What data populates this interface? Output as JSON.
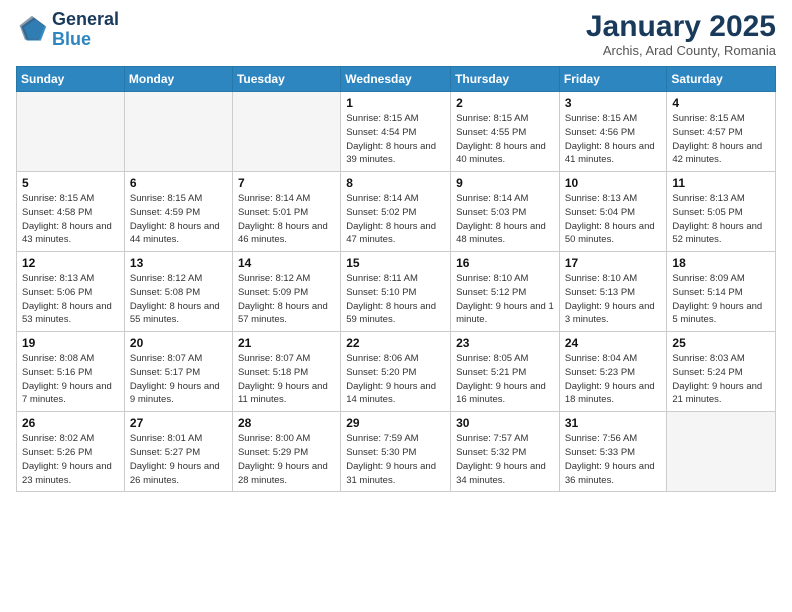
{
  "header": {
    "logo_general": "General",
    "logo_blue": "Blue",
    "month_title": "January 2025",
    "subtitle": "Archis, Arad County, Romania"
  },
  "weekdays": [
    "Sunday",
    "Monday",
    "Tuesday",
    "Wednesday",
    "Thursday",
    "Friday",
    "Saturday"
  ],
  "weeks": [
    [
      {
        "day": "",
        "info": ""
      },
      {
        "day": "",
        "info": ""
      },
      {
        "day": "",
        "info": ""
      },
      {
        "day": "1",
        "info": "Sunrise: 8:15 AM\nSunset: 4:54 PM\nDaylight: 8 hours\nand 39 minutes."
      },
      {
        "day": "2",
        "info": "Sunrise: 8:15 AM\nSunset: 4:55 PM\nDaylight: 8 hours\nand 40 minutes."
      },
      {
        "day": "3",
        "info": "Sunrise: 8:15 AM\nSunset: 4:56 PM\nDaylight: 8 hours\nand 41 minutes."
      },
      {
        "day": "4",
        "info": "Sunrise: 8:15 AM\nSunset: 4:57 PM\nDaylight: 8 hours\nand 42 minutes."
      }
    ],
    [
      {
        "day": "5",
        "info": "Sunrise: 8:15 AM\nSunset: 4:58 PM\nDaylight: 8 hours\nand 43 minutes."
      },
      {
        "day": "6",
        "info": "Sunrise: 8:15 AM\nSunset: 4:59 PM\nDaylight: 8 hours\nand 44 minutes."
      },
      {
        "day": "7",
        "info": "Sunrise: 8:14 AM\nSunset: 5:01 PM\nDaylight: 8 hours\nand 46 minutes."
      },
      {
        "day": "8",
        "info": "Sunrise: 8:14 AM\nSunset: 5:02 PM\nDaylight: 8 hours\nand 47 minutes."
      },
      {
        "day": "9",
        "info": "Sunrise: 8:14 AM\nSunset: 5:03 PM\nDaylight: 8 hours\nand 48 minutes."
      },
      {
        "day": "10",
        "info": "Sunrise: 8:13 AM\nSunset: 5:04 PM\nDaylight: 8 hours\nand 50 minutes."
      },
      {
        "day": "11",
        "info": "Sunrise: 8:13 AM\nSunset: 5:05 PM\nDaylight: 8 hours\nand 52 minutes."
      }
    ],
    [
      {
        "day": "12",
        "info": "Sunrise: 8:13 AM\nSunset: 5:06 PM\nDaylight: 8 hours\nand 53 minutes."
      },
      {
        "day": "13",
        "info": "Sunrise: 8:12 AM\nSunset: 5:08 PM\nDaylight: 8 hours\nand 55 minutes."
      },
      {
        "day": "14",
        "info": "Sunrise: 8:12 AM\nSunset: 5:09 PM\nDaylight: 8 hours\nand 57 minutes."
      },
      {
        "day": "15",
        "info": "Sunrise: 8:11 AM\nSunset: 5:10 PM\nDaylight: 8 hours\nand 59 minutes."
      },
      {
        "day": "16",
        "info": "Sunrise: 8:10 AM\nSunset: 5:12 PM\nDaylight: 9 hours\nand 1 minute."
      },
      {
        "day": "17",
        "info": "Sunrise: 8:10 AM\nSunset: 5:13 PM\nDaylight: 9 hours\nand 3 minutes."
      },
      {
        "day": "18",
        "info": "Sunrise: 8:09 AM\nSunset: 5:14 PM\nDaylight: 9 hours\nand 5 minutes."
      }
    ],
    [
      {
        "day": "19",
        "info": "Sunrise: 8:08 AM\nSunset: 5:16 PM\nDaylight: 9 hours\nand 7 minutes."
      },
      {
        "day": "20",
        "info": "Sunrise: 8:07 AM\nSunset: 5:17 PM\nDaylight: 9 hours\nand 9 minutes."
      },
      {
        "day": "21",
        "info": "Sunrise: 8:07 AM\nSunset: 5:18 PM\nDaylight: 9 hours\nand 11 minutes."
      },
      {
        "day": "22",
        "info": "Sunrise: 8:06 AM\nSunset: 5:20 PM\nDaylight: 9 hours\nand 14 minutes."
      },
      {
        "day": "23",
        "info": "Sunrise: 8:05 AM\nSunset: 5:21 PM\nDaylight: 9 hours\nand 16 minutes."
      },
      {
        "day": "24",
        "info": "Sunrise: 8:04 AM\nSunset: 5:23 PM\nDaylight: 9 hours\nand 18 minutes."
      },
      {
        "day": "25",
        "info": "Sunrise: 8:03 AM\nSunset: 5:24 PM\nDaylight: 9 hours\nand 21 minutes."
      }
    ],
    [
      {
        "day": "26",
        "info": "Sunrise: 8:02 AM\nSunset: 5:26 PM\nDaylight: 9 hours\nand 23 minutes."
      },
      {
        "day": "27",
        "info": "Sunrise: 8:01 AM\nSunset: 5:27 PM\nDaylight: 9 hours\nand 26 minutes."
      },
      {
        "day": "28",
        "info": "Sunrise: 8:00 AM\nSunset: 5:29 PM\nDaylight: 9 hours\nand 28 minutes."
      },
      {
        "day": "29",
        "info": "Sunrise: 7:59 AM\nSunset: 5:30 PM\nDaylight: 9 hours\nand 31 minutes."
      },
      {
        "day": "30",
        "info": "Sunrise: 7:57 AM\nSunset: 5:32 PM\nDaylight: 9 hours\nand 34 minutes."
      },
      {
        "day": "31",
        "info": "Sunrise: 7:56 AM\nSunset: 5:33 PM\nDaylight: 9 hours\nand 36 minutes."
      },
      {
        "day": "",
        "info": ""
      }
    ]
  ]
}
